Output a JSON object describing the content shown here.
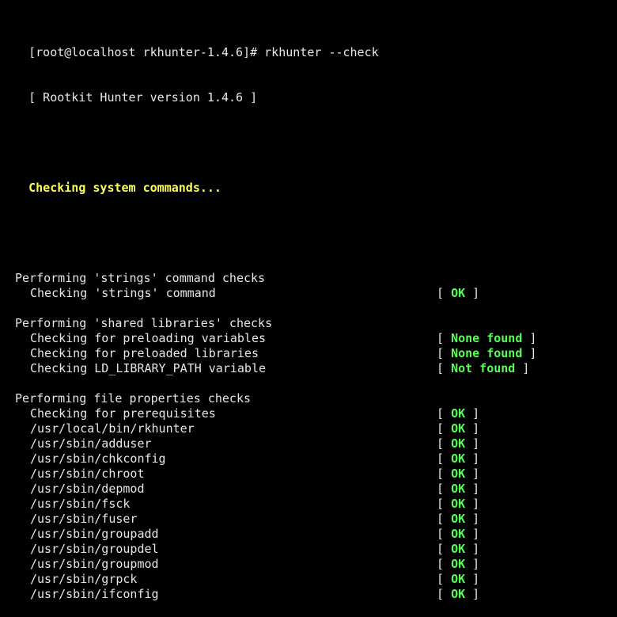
{
  "terminal": {
    "prompt_line": "[root@localhost rkhunter-1.4.6]# rkhunter --check",
    "version_line": "[ Rootkit Hunter version 1.4.6 ]",
    "section_title": "Checking system commands...",
    "bracket_open": "[",
    "bracket_close": "]",
    "groups": [
      {
        "title": "Performing 'strings' command checks",
        "checks": [
          {
            "label": "Checking 'strings' command",
            "result": "OK"
          }
        ]
      },
      {
        "title": "Performing 'shared libraries' checks",
        "checks": [
          {
            "label": "Checking for preloading variables",
            "result": "None found"
          },
          {
            "label": "Checking for preloaded libraries",
            "result": "None found"
          },
          {
            "label": "Checking LD_LIBRARY_PATH variable",
            "result": "Not found"
          }
        ]
      },
      {
        "title": "Performing file properties checks",
        "checks": [
          {
            "label": "Checking for prerequisites",
            "result": "OK"
          },
          {
            "label": "/usr/local/bin/rkhunter",
            "result": "OK"
          },
          {
            "label": "/usr/sbin/adduser",
            "result": "OK"
          },
          {
            "label": "/usr/sbin/chkconfig",
            "result": "OK"
          },
          {
            "label": "/usr/sbin/chroot",
            "result": "OK"
          },
          {
            "label": "/usr/sbin/depmod",
            "result": "OK"
          },
          {
            "label": "/usr/sbin/fsck",
            "result": "OK"
          },
          {
            "label": "/usr/sbin/fuser",
            "result": "OK"
          },
          {
            "label": "/usr/sbin/groupadd",
            "result": "OK"
          },
          {
            "label": "/usr/sbin/groupdel",
            "result": "OK"
          },
          {
            "label": "/usr/sbin/groupmod",
            "result": "OK"
          },
          {
            "label": "/usr/sbin/grpck",
            "result": "OK"
          },
          {
            "label": "/usr/sbin/ifconfig",
            "result": "OK"
          }
        ]
      }
    ],
    "colors": {
      "background": "#000000",
      "text": "#e6e6e6",
      "section_header": "#ffff55",
      "result_ok": "#55ff55"
    }
  }
}
